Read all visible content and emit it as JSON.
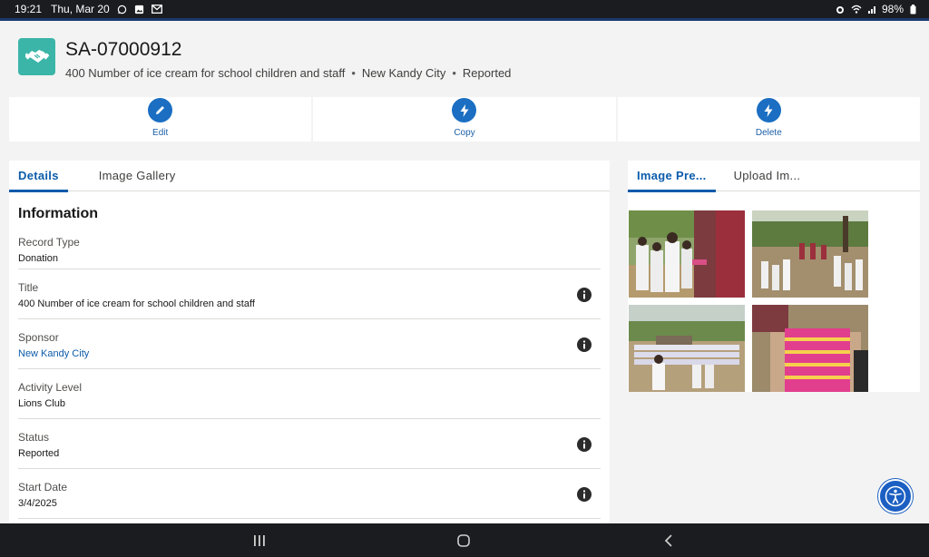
{
  "status_bar": {
    "time": "19:21",
    "date": "Thu, Mar 20",
    "battery": "98%",
    "icons": [
      "whatsapp-icon",
      "gallery-icon",
      "gmail-icon",
      "alarm-icon",
      "wifi-icon",
      "signal-icon",
      "battery-icon"
    ]
  },
  "header": {
    "icon": "handshake-icon",
    "icon_color": "#3bb5a8",
    "title": "SA-07000912",
    "subtitle_parts": [
      "400 Number of ice cream for school children and staff",
      "New Kandy City",
      "Reported"
    ]
  },
  "actions": [
    {
      "label": "Edit",
      "icon": "pencil-icon"
    },
    {
      "label": "Copy",
      "icon": "lightning-icon"
    },
    {
      "label": "Delete",
      "icon": "lightning-icon"
    }
  ],
  "left_tabs": [
    {
      "label": "Details",
      "active": true
    },
    {
      "label": "Image Gallery",
      "active": false
    }
  ],
  "section_title": "Information",
  "fields": [
    {
      "label": "Record Type",
      "value": "Donation",
      "link": false,
      "info": false
    },
    {
      "label": "Title",
      "value": "400 Number of ice cream for school children and staff",
      "link": false,
      "info": true
    },
    {
      "label": "Sponsor",
      "value": "New Kandy City",
      "link": true,
      "info": true
    },
    {
      "label": "Activity Level",
      "value": "Lions Club",
      "link": false,
      "info": false
    },
    {
      "label": "Status",
      "value": "Reported",
      "link": false,
      "info": true
    },
    {
      "label": "Start Date",
      "value": "3/4/2025",
      "link": false,
      "info": true
    }
  ],
  "right_tabs": [
    {
      "label": "Image Pre...",
      "active": true
    },
    {
      "label": "Upload Im...",
      "active": false
    }
  ],
  "gallery": [
    {
      "name": "photo-children-receiving-ice-cream"
    },
    {
      "name": "photo-children-lined-up-field"
    },
    {
      "name": "photo-school-assembly-ground"
    },
    {
      "name": "photo-ice-cream-boxes"
    }
  ],
  "colors": {
    "accent": "#0b5cab",
    "action_button": "#1b6ec2",
    "system_bar": "#1b1c20"
  }
}
